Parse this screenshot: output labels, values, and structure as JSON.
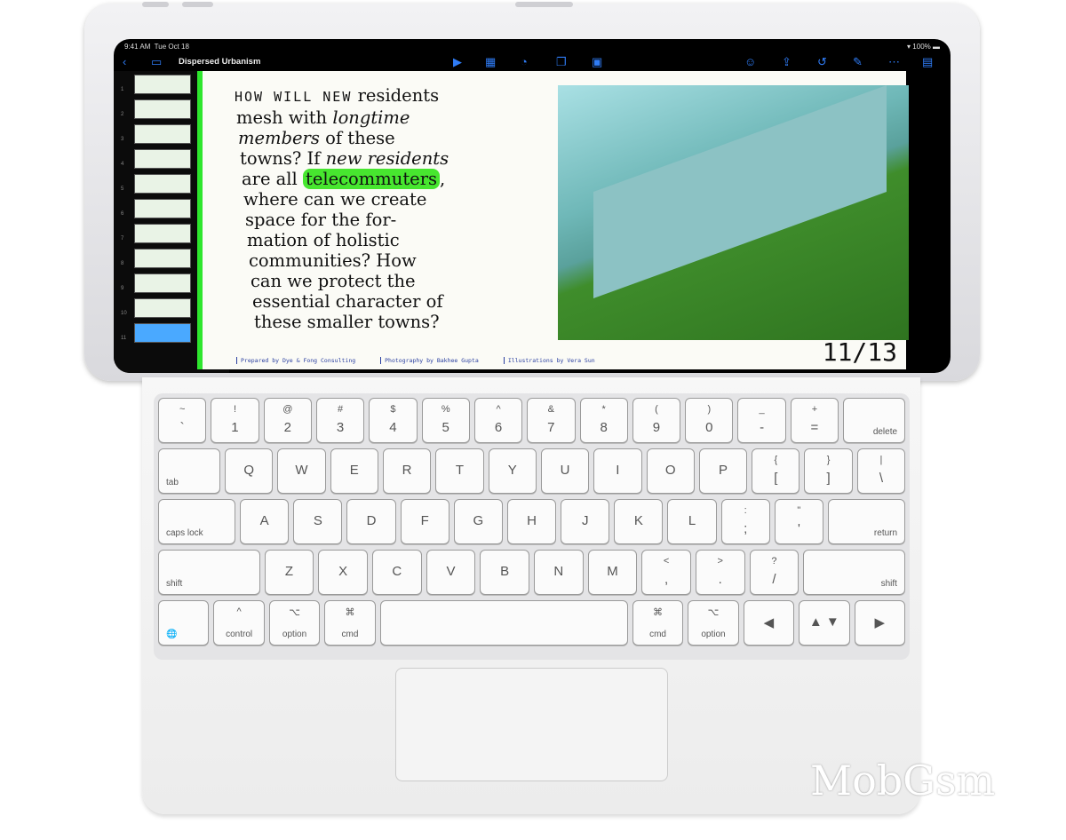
{
  "status": {
    "time": "9:41 AM",
    "date": "Tue Oct 18",
    "battery": "100%"
  },
  "toolbar": {
    "title": "Dispersed Urbanism",
    "icons": [
      "back-icon",
      "sidebar-icon",
      "play-icon",
      "table-icon",
      "chart-icon",
      "shapes-icon",
      "media-icon",
      "collaborate-icon",
      "share-icon",
      "undo-icon",
      "format-brush-icon",
      "more-icon",
      "document-icon"
    ]
  },
  "sidebar": {
    "slide_numbers": [
      "1",
      "2",
      "3",
      "4",
      "5",
      "6",
      "7",
      "8",
      "9",
      "10",
      "11"
    ],
    "selected": "11"
  },
  "slide": {
    "lines": [
      "HOW WILL NEW residents",
      "mesh with longtime",
      "members of these",
      "towns? If new residents",
      "are all telecommuters,",
      "where can we create",
      "space for the for-",
      "mation of holistic",
      "communities? How",
      "can we protect the",
      "essential character of",
      "these smaller towns?"
    ],
    "highlight": "telecommuters",
    "page": "11/13",
    "credits": [
      "Prepared by Dye & Fong Consulting",
      "Photography by  Bakhee Gupta",
      "Illustrations by Vera Sun"
    ]
  },
  "keyboard": {
    "rows": [
      [
        {
          "t": "~",
          "b": "`"
        },
        {
          "t": "!",
          "b": "1"
        },
        {
          "t": "@",
          "b": "2"
        },
        {
          "t": "#",
          "b": "3"
        },
        {
          "t": "$",
          "b": "4"
        },
        {
          "t": "%",
          "b": "5"
        },
        {
          "t": "^",
          "b": "6"
        },
        {
          "t": "&",
          "b": "7"
        },
        {
          "t": "*",
          "b": "8"
        },
        {
          "t": "(",
          "b": "9"
        },
        {
          "t": ")",
          "b": "0"
        },
        {
          "t": "_",
          "b": "-"
        },
        {
          "t": "+",
          "b": "="
        },
        {
          "sr": "delete"
        }
      ],
      [
        {
          "sl": "tab"
        },
        {
          "c": "Q"
        },
        {
          "c": "W"
        },
        {
          "c": "E"
        },
        {
          "c": "R"
        },
        {
          "c": "T"
        },
        {
          "c": "Y"
        },
        {
          "c": "U"
        },
        {
          "c": "I"
        },
        {
          "c": "O"
        },
        {
          "c": "P"
        },
        {
          "t": "{",
          "b": "["
        },
        {
          "t": "}",
          "b": "]"
        },
        {
          "t": "|",
          "b": "\\"
        }
      ],
      [
        {
          "sl": "caps lock"
        },
        {
          "c": "A"
        },
        {
          "c": "S"
        },
        {
          "c": "D"
        },
        {
          "c": "F"
        },
        {
          "c": "G"
        },
        {
          "c": "H"
        },
        {
          "c": "J"
        },
        {
          "c": "K"
        },
        {
          "c": "L"
        },
        {
          "t": ":",
          "b": ";"
        },
        {
          "t": "\"",
          "b": "'"
        },
        {
          "sr": "return"
        }
      ],
      [
        {
          "sl": "shift"
        },
        {
          "c": "Z"
        },
        {
          "c": "X"
        },
        {
          "c": "C"
        },
        {
          "c": "V"
        },
        {
          "c": "B"
        },
        {
          "c": "N"
        },
        {
          "c": "M"
        },
        {
          "t": "<",
          "b": ","
        },
        {
          "t": ">",
          "b": "."
        },
        {
          "t": "?",
          "b": "/"
        },
        {
          "sr": "shift"
        }
      ],
      [
        {
          "sl": "🌐"
        },
        {
          "t": "^",
          "sc": "control"
        },
        {
          "t": "⌥",
          "sc": "option"
        },
        {
          "t": "⌘",
          "sc": "cmd"
        },
        {
          "c": ""
        },
        {
          "t": "⌘",
          "sc": "cmd"
        },
        {
          "t": "⌥",
          "sc": "option"
        },
        {
          "c": "◀"
        },
        {
          "c": "▲ ▼"
        },
        {
          "c": "▶"
        }
      ]
    ]
  },
  "watermark": "MobGsm"
}
